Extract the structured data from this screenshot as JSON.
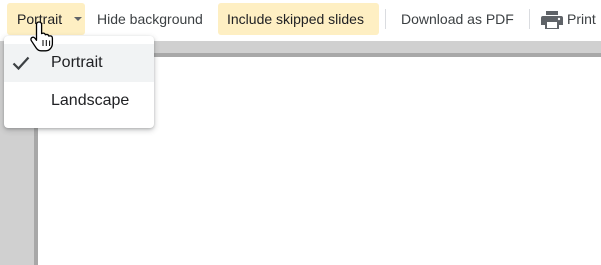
{
  "toolbar": {
    "orientation_label": "Portrait",
    "hide_background_label": "Hide background",
    "include_skipped_label": "Include skipped slides",
    "download_pdf_label": "Download as PDF",
    "print_label": "Print"
  },
  "orientation_menu": {
    "items": [
      {
        "label": "Portrait",
        "selected": true
      },
      {
        "label": "Landscape",
        "selected": false
      }
    ]
  },
  "icons": {
    "orientation_caret": "chevron-down-icon",
    "selected_mark": "checkmark-icon",
    "print": "printer-icon",
    "cursor": "hand-pointer-cursor"
  },
  "colors": {
    "active_button_background": "#feefc3",
    "menu_hover_background": "#f1f3f4",
    "preview_background": "#d0d0d0",
    "text": "#3c4043"
  }
}
